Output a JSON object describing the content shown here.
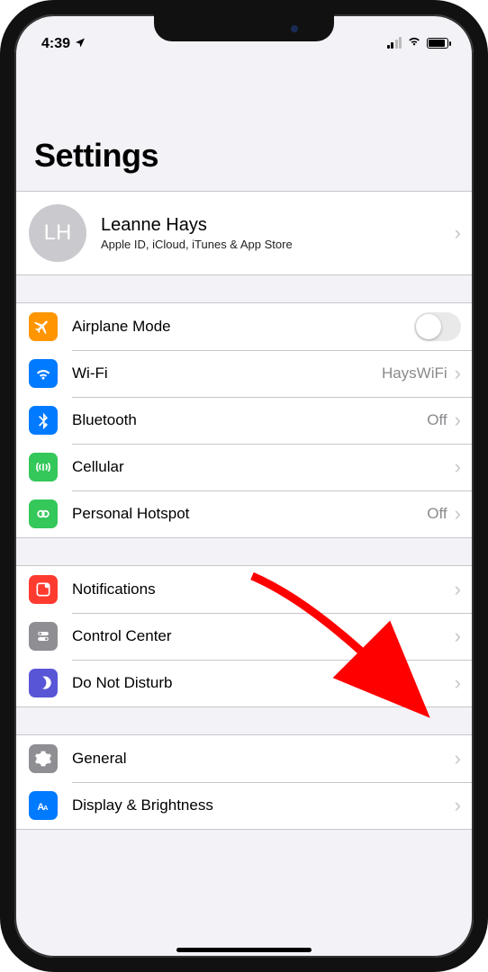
{
  "status": {
    "time": "4:39",
    "location_icon": "location-arrow"
  },
  "header": {
    "title": "Settings"
  },
  "profile": {
    "initials": "LH",
    "name": "Leanne Hays",
    "subtitle": "Apple ID, iCloud, iTunes & App Store"
  },
  "groups": [
    {
      "id": "connectivity",
      "rows": [
        {
          "id": "airplane",
          "label": "Airplane Mode",
          "icon": "airplane",
          "icon_bg": "#ff9500",
          "control": "toggle",
          "toggle_on": false
        },
        {
          "id": "wifi",
          "label": "Wi-Fi",
          "icon": "wifi",
          "icon_bg": "#007aff",
          "value": "HaysWiFi",
          "control": "chevron"
        },
        {
          "id": "bluetooth",
          "label": "Bluetooth",
          "icon": "bluetooth",
          "icon_bg": "#007aff",
          "value": "Off",
          "control": "chevron"
        },
        {
          "id": "cellular",
          "label": "Cellular",
          "icon": "cellular",
          "icon_bg": "#34c759",
          "control": "chevron"
        },
        {
          "id": "hotspot",
          "label": "Personal Hotspot",
          "icon": "hotspot",
          "icon_bg": "#34c759",
          "value": "Off",
          "control": "chevron"
        }
      ]
    },
    {
      "id": "notifications",
      "rows": [
        {
          "id": "notifications",
          "label": "Notifications",
          "icon": "notifications",
          "icon_bg": "#ff3b30",
          "control": "chevron"
        },
        {
          "id": "controlcenter",
          "label": "Control Center",
          "icon": "controlcenter",
          "icon_bg": "#8e8e93",
          "control": "chevron"
        },
        {
          "id": "dnd",
          "label": "Do Not Disturb",
          "icon": "moon",
          "icon_bg": "#5856d6",
          "control": "chevron"
        }
      ]
    },
    {
      "id": "general",
      "rows": [
        {
          "id": "general",
          "label": "General",
          "icon": "gear",
          "icon_bg": "#8e8e93",
          "control": "chevron"
        },
        {
          "id": "display",
          "label": "Display & Brightness",
          "icon": "display",
          "icon_bg": "#007aff",
          "control": "chevron"
        }
      ]
    }
  ],
  "annotation": {
    "type": "arrow",
    "color": "#ff0000",
    "points_to_row": "controlcenter"
  }
}
